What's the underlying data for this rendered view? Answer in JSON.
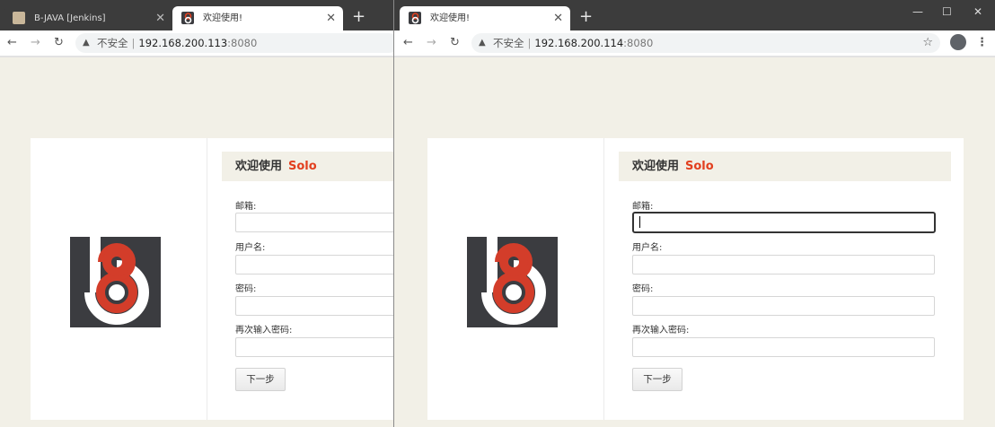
{
  "left_window": {
    "tabs": [
      {
        "title": "B-JAVA [Jenkins]",
        "active": false
      },
      {
        "title": "欢迎使用!",
        "active": true
      }
    ],
    "address": {
      "security_label": "不安全",
      "host": "192.168.200.113",
      "port": ":8080"
    }
  },
  "right_window": {
    "tabs": [
      {
        "title": "欢迎使用!",
        "active": true
      }
    ],
    "address": {
      "security_label": "不安全",
      "host": "192.168.200.114",
      "port": ":8080"
    }
  },
  "page": {
    "heading_prefix": "欢迎使用",
    "heading_brand": "Solo",
    "fields": [
      {
        "label": "邮箱:",
        "value": ""
      },
      {
        "label": "用户名:",
        "value": ""
      },
      {
        "label": "密码:",
        "value": ""
      },
      {
        "label": "再次输入密码:",
        "value": ""
      }
    ],
    "next_button": "下一步"
  },
  "icons": {
    "back": "back-arrow-icon",
    "forward": "forward-arrow-icon",
    "reload": "reload-icon",
    "warning": "warning-triangle-icon",
    "new_tab": "plus-icon",
    "tab_close": "close-icon",
    "bookmark": "star-icon",
    "profile": "account-icon",
    "menu": "kebab-menu-icon"
  },
  "colors": {
    "brand": "#e23f1e",
    "page_bg": "#f2f0e7",
    "tabstrip": "#3c3c3c"
  }
}
